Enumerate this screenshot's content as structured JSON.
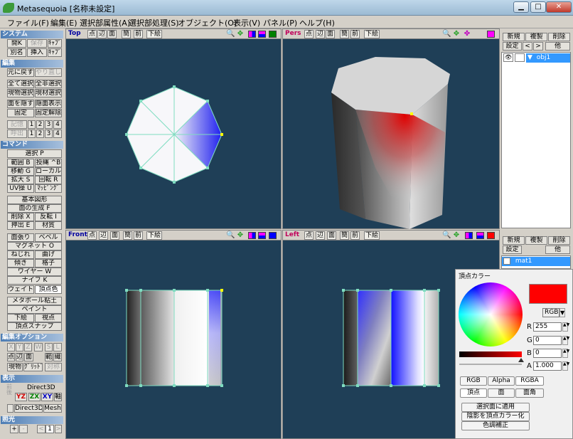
{
  "window": {
    "title": "Metasequoia [名称未設定]",
    "minimize": "▁",
    "maximize": "□",
    "close": "✕"
  },
  "menu": [
    "ファイル(F)",
    "編集(E)",
    "選択部属性(A)",
    "選択部処理(S)",
    "オブジェクト(O)",
    "表示(V)",
    "パネル(P)",
    "ヘルプ(H)"
  ],
  "left": {
    "system": {
      "header": "システム",
      "buttons": [
        "開K",
        "保存",
        "ｷｬﾌﾟ",
        "別名",
        "挿入",
        "ｷｬﾌﾟ"
      ]
    },
    "edit": {
      "header": "編集",
      "undo": "元に戻す",
      "redo": "やり直し",
      "sel_all": "全て選択",
      "desel_all": "全非選択",
      "sel_obj": "現物選択",
      "sel_mat": "現材選択",
      "hide": "面を隠す",
      "show": "隠面表示",
      "fix": "固定",
      "unfix": "固定解除",
      "memo": "記憶",
      "recall": "呼出",
      "slots": [
        "1",
        "2",
        "3",
        "4"
      ]
    },
    "command": {
      "header": "コマンド",
      "select": "選択 P",
      "range": "範囲 B",
      "lasso": "投縄 ^B",
      "move": "移動 G",
      "local": "ローカル L",
      "scale": "拡大 S",
      "rotate": "回転 R",
      "uv": "UV操 U",
      "mapping": "ﾏｯﾋﾟﾝｸﾞ",
      "basic": "基本図形",
      "face_gen": "面の生成 F",
      "delete": "削除 X",
      "flip": "反転 I",
      "extrude": "押出 E",
      "material": "材質",
      "face_cut": "面張り",
      "bevel": "ベベル",
      "magnet": "マグネット O",
      "twist": "ねじれ",
      "bend": "曲げ",
      "tilt": "傾き",
      "lattice": "格子",
      "wire": "ワイヤー W",
      "knife": "ナイフ K",
      "weight": "ウェイト",
      "vertex_color": "頂点色",
      "metaball": "メタボール粘土",
      "paint": "ペイント",
      "draw": "下絵",
      "viewpoint": "視点",
      "vsnap": "頂点スナップ"
    },
    "editopt": {
      "header": "編集オプション",
      "x": "X",
      "y": "Y",
      "z": "Z",
      "w": "W",
      "s": "S",
      "l": "L",
      "pt": "点",
      "edge": "辺",
      "face": "面",
      "range": "範",
      "multi": "繊",
      "cur_obj": "現物",
      "grid": "ｸﾞﾘｯﾄﾞ",
      "sym": "対称"
    },
    "display": {
      "header": "表示",
      "engine": "Direct3D",
      "yz": "YZ",
      "zx": "ZX",
      "xy": "XY",
      "axis": "軸",
      "direct3d": "Direct3D",
      "mesh": "Mesh",
      "cap": "前後"
    },
    "light": {
      "header": "照光",
      "plus": "+",
      "minus": "-",
      "prev": "<",
      "num": "1",
      "next": ">"
    }
  },
  "viewports": {
    "top": {
      "label": "Top",
      "buttons": [
        "点",
        "辺",
        "面",
        "簡",
        "前",
        "下絵"
      ]
    },
    "pers": {
      "label": "Pers",
      "buttons": [
        "点",
        "辺",
        "面",
        "簡",
        "前",
        "下絵"
      ]
    },
    "front": {
      "label": "Front",
      "buttons": [
        "点",
        "辺",
        "面",
        "簡",
        "前",
        "下絵"
      ]
    },
    "left": {
      "label": "Left",
      "buttons": [
        "点",
        "辺",
        "面",
        "簡",
        "前",
        "下絵"
      ]
    }
  },
  "colors": {
    "bg": "#1f3f57",
    "red": "#ff0000",
    "blue": "#0000ff",
    "wire": "#7fdcc0"
  },
  "objpanel": {
    "new": "新規",
    "dup": "複製",
    "del": "削除",
    "settings": "設定",
    "prev": "<",
    "next": ">",
    "other": "他",
    "obj_name": "obj1",
    "expand": "▼"
  },
  "matpanel": {
    "new": "新規",
    "dup": "複製",
    "del": "削除",
    "settings": "設定",
    "other": "他",
    "mat_name": "mat1"
  },
  "vertexcolor": {
    "title": "頂点カラー",
    "mode": "RGB",
    "r_label": "R",
    "g_label": "G",
    "b_label": "B",
    "a_label": "A",
    "r": "255",
    "g": "0",
    "b": "0",
    "a": "1.000",
    "tabs": [
      "RGB",
      "Alpha",
      "RGBA"
    ],
    "targets": [
      "頂点",
      "面",
      "面角"
    ],
    "apply": "選択面に適用",
    "shade": "陰影を頂点カラー化",
    "tone": "色調補正"
  }
}
